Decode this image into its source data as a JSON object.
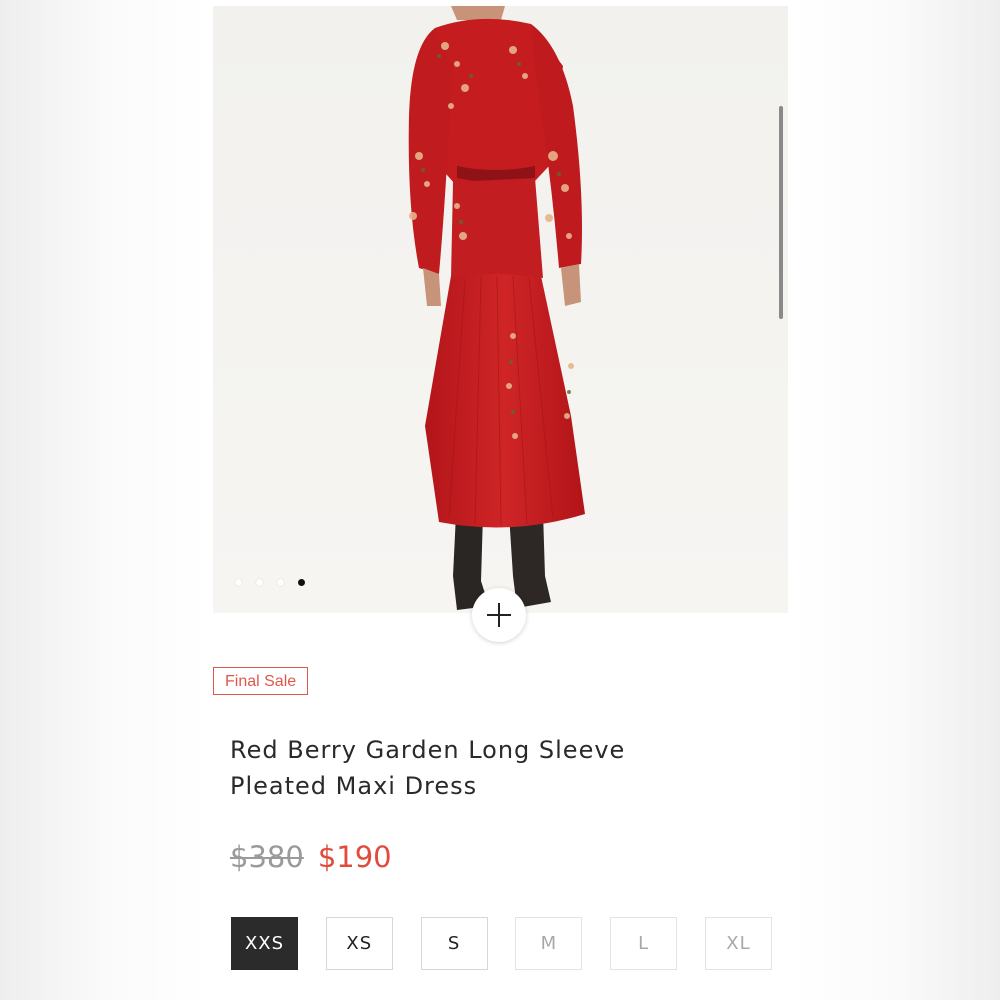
{
  "product": {
    "badge": "Final Sale",
    "title_line1": "Red Berry Garden Long Sleeve",
    "title_line2": "Pleated Maxi Dress",
    "original_price": "$380",
    "sale_price": "$190"
  },
  "gallery": {
    "image_count": 4,
    "active_index": 3
  },
  "sizes": [
    {
      "label": "XXS",
      "state": "selected"
    },
    {
      "label": "XS",
      "state": "available"
    },
    {
      "label": "S",
      "state": "available"
    },
    {
      "label": "M",
      "state": "unavailable"
    },
    {
      "label": "L",
      "state": "unavailable"
    },
    {
      "label": "XL",
      "state": "unavailable"
    }
  ],
  "icons": {
    "zoom": "plus-icon"
  },
  "colors": {
    "accent": "#e04b3c",
    "badge_border": "#e0574a",
    "dress_red": "#c51d1f",
    "selected_size_bg": "#2b2b2b"
  }
}
